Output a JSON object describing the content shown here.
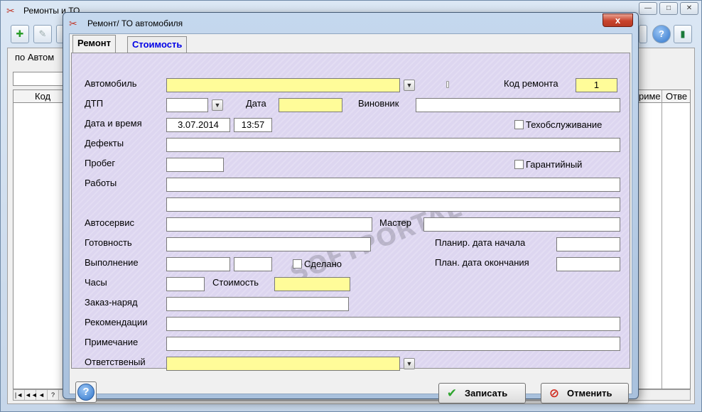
{
  "background_window": {
    "title": "Ремонты и ТО",
    "filter_tab_label": "по Автом",
    "grid_columns": {
      "code": "Код",
      "right1": "риме",
      "right2": "Отве"
    },
    "nav_glyphs": [
      "|◄",
      "◄◄",
      "◄",
      "?"
    ],
    "icons": {
      "app": "wrench-screwdriver-icon",
      "add": "add-icon",
      "edit": "edit-icon",
      "help": "help-icon",
      "exit": "exit-door-icon"
    }
  },
  "dialog": {
    "title": "Ремонт/ ТО автомобиля",
    "close_glyph": "x",
    "tabs": [
      {
        "label": "Ремонт",
        "active": true
      },
      {
        "label": "Стоимость",
        "active": false
      }
    ],
    "form": {
      "car": {
        "label": "Автомобиль",
        "value": ""
      },
      "repair_code": {
        "label": "Код ремонта",
        "value": "1"
      },
      "accident": {
        "label": "ДТП",
        "value": ""
      },
      "date": {
        "label": "Дата",
        "value": ""
      },
      "culprit": {
        "label": "Виновник",
        "value": ""
      },
      "datetime": {
        "label": "Дата и время",
        "date": "3.07.2014",
        "time": "13:57"
      },
      "maintenance": {
        "label": "Техобслуживание",
        "checked": false
      },
      "defects": {
        "label": "Дефекты",
        "value": ""
      },
      "mileage": {
        "label": "Пробег",
        "value": ""
      },
      "warranty": {
        "label": "Гарантийный",
        "checked": false
      },
      "works": {
        "label": "Работы",
        "value1": "",
        "value2": ""
      },
      "service": {
        "label": "Автосервис",
        "value": ""
      },
      "master": {
        "label": "Мастер",
        "value": ""
      },
      "readiness": {
        "label": "Готовность",
        "value": ""
      },
      "planned_start": {
        "label": "Планир. дата начала",
        "value": ""
      },
      "execution": {
        "label": "Выполнение",
        "value1": "",
        "value2": ""
      },
      "done": {
        "label": "Сделано",
        "checked": false
      },
      "planned_end": {
        "label": "План. дата окончания",
        "value": ""
      },
      "hours": {
        "label": "Часы",
        "value": ""
      },
      "cost": {
        "label": "Стоимость",
        "value": ""
      },
      "work_order": {
        "label": "Заказ-наряд",
        "value": ""
      },
      "recommendations": {
        "label": "Рекомендации",
        "value": ""
      },
      "note": {
        "label": "Примечание",
        "value": ""
      },
      "responsible": {
        "label": "Ответственый",
        "value": ""
      }
    },
    "dropdown_glyph": "▼",
    "help_glyph": "?",
    "buttons": {
      "save": "Записать",
      "cancel": "Отменить"
    },
    "button_icons": {
      "save": "checkmark-icon",
      "cancel": "cancel-icon"
    }
  },
  "watermark": "SOFTPORTAL",
  "colors": {
    "required_field": "#fffc99",
    "panel_bg": "#ddd6f0",
    "inactive_tab_text": "#0000e6",
    "close_button": "#c8442d"
  }
}
